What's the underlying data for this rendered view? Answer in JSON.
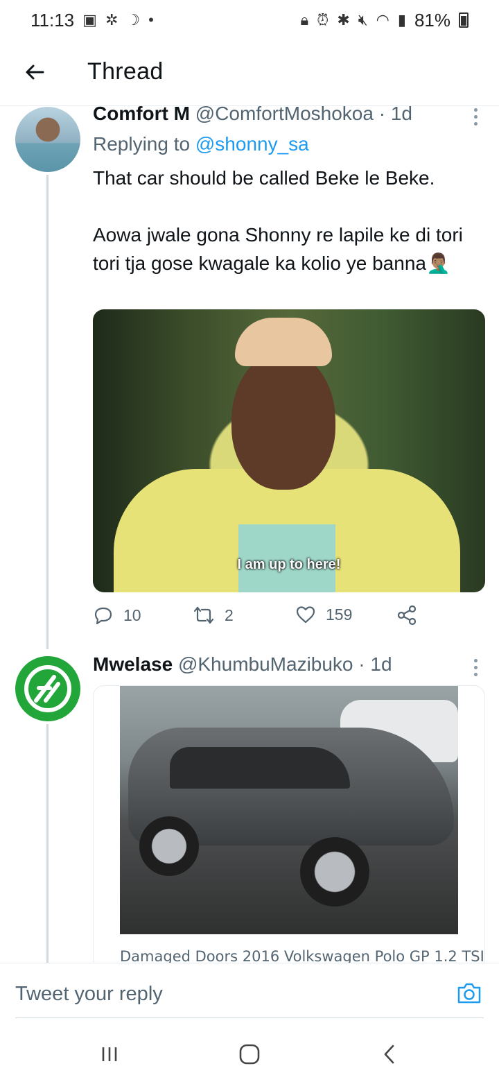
{
  "status_bar": {
    "time": "11:13",
    "battery": "81%",
    "left_icons": [
      "gallery-icon",
      "fan-icon",
      "moon-icon",
      "dot-icon"
    ],
    "right_icons": [
      "lock-icon",
      "alarm-icon",
      "bluetooth-icon",
      "mute-icon",
      "wifi-icon",
      "signal-icon",
      "battery-icon"
    ]
  },
  "header": {
    "title": "Thread"
  },
  "tweets": [
    {
      "name": "Comfort M",
      "handle": "@ComfortMoshokoa",
      "age": "· 1d",
      "replying_prefix": "Replying to",
      "replying_handle": "@shonny_sa",
      "text_line1": "That car should be called Beke le Beke.",
      "text_line2": "Aowa jwale gona Shonny re lapile ke di tori tori tja gose kwagale ka kolio ye banna🤦🏽‍♂️",
      "image_caption": "I am up to here!",
      "reply_count": "10",
      "retweet_count": "2",
      "like_count": "159"
    },
    {
      "name": "Mwelase",
      "handle": "@KhumbuMazibuko",
      "age": "· 1d",
      "card_title": "Damaged Doors 2016 Volkswagen Polo GP 1.2 TSI"
    }
  ],
  "reply_bar": {
    "placeholder": "Tweet your reply"
  },
  "colors": {
    "accent": "#1d9bf0",
    "secondary_text": "#536471",
    "primary_text": "#0f1419",
    "brand_green": "#22a63a"
  }
}
